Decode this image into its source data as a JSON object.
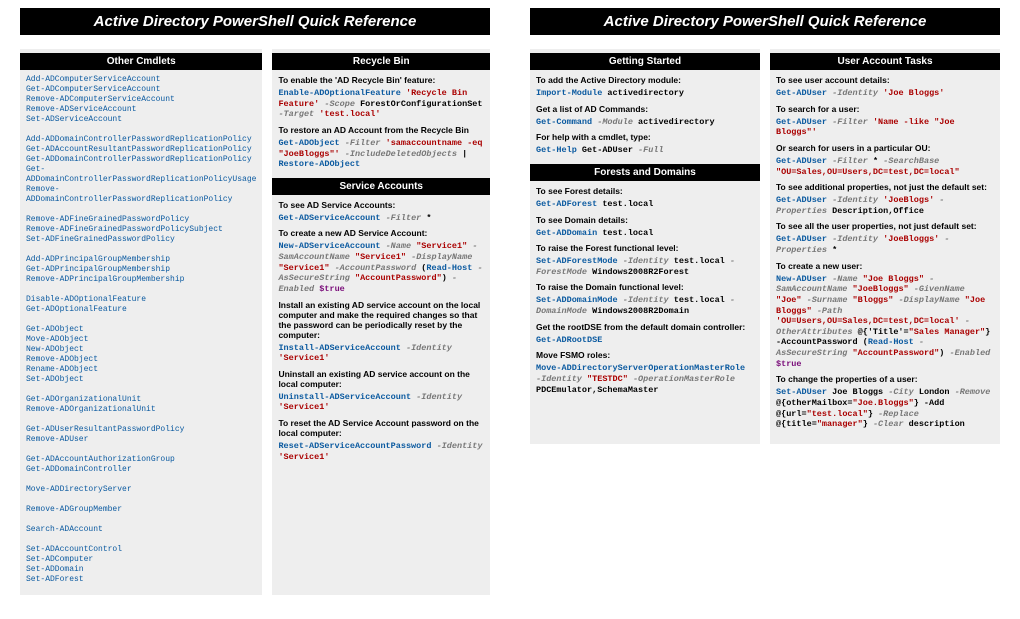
{
  "titles": {
    "left": "Active Directory PowerShell Quick Reference",
    "right": "Active Directory PowerShell Quick Reference"
  },
  "left": {
    "col1": {
      "header": "Other Cmdlets",
      "cmdlets": [
        "<span class='c-bl'>Add-ADComputerServiceAccount</span>",
        "<span class='c-bl'>Get-ADComputerServiceAccount</span>",
        "<span class='c-bl'>Remove-ADComputerServiceAccount</span>",
        "<span class='c-bl'>Remove-ADServiceAccount</span>",
        "<span class='c-bl'>Set-ADServiceAccount</span>",
        "",
        "<span class='c-bl'>Add-ADDomainControllerPasswordReplicationPolicy</span>",
        "<span class='c-bl'>Get-ADAccountResultantPasswordReplicationPolicy</span>",
        "<span class='c-bl'>Get-ADDomainControllerPasswordReplicationPolicy</span>",
        "<span class='c-bl'>Get-ADDomainControllerPasswordReplicationPolicyUsage</span>",
        "<span class='c-bl'>Remove-ADDomainControllerPasswordReplicationPolicy</span>",
        "",
        "<span class='c-bl'>Remove-ADFineGrainedPasswordPolicy</span>",
        "<span class='c-bl'>Remove-ADFineGrainedPasswordPolicySubject</span>",
        "<span class='c-bl'>Set-ADFineGrainedPasswordPolicy</span>",
        "",
        "<span class='c-bl'>Add-ADPrincipalGroupMembership</span>",
        "<span class='c-bl'>Get-ADPrincipalGroupMembership</span>",
        "<span class='c-bl'>Remove-ADPrincipalGroupMembership</span>",
        "",
        "<span class='c-bl'>Disable-ADOptionalFeature</span>",
        "<span class='c-bl'>Get-ADOptionalFeature</span>",
        "",
        "<span class='c-bl'>Get-ADObject</span>",
        "<span class='c-bl'>Move-ADObject</span>",
        "<span class='c-bl'>New-ADObject</span>",
        "<span class='c-bl'>Remove-ADObject</span>",
        "<span class='c-bl'>Rename-ADObject</span>",
        "<span class='c-bl'>Set-ADObject</span>",
        "",
        "<span class='c-bl'>Get-ADOrganizationalUnit</span>",
        "<span class='c-bl'>Remove-ADOrganizationalUnit</span>",
        "",
        "<span class='c-bl'>Get-ADUserResultantPasswordPolicy</span>",
        "<span class='c-bl'>Remove-ADUser</span>",
        "",
        "<span class='c-bl'>Get-ADAccountAuthorizationGroup</span>",
        "<span class='c-bl'>Get-ADDomainController</span>",
        "",
        "<span class='c-bl'>Move-ADDirectoryServer</span>",
        "",
        "<span class='c-bl'>Remove-ADGroupMember</span>",
        "",
        "<span class='c-bl'>Search-ADAccount</span>",
        "",
        "<span class='c-bl'>Set-ADAccountControl</span>",
        "<span class='c-bl'>Set-ADComputer</span>",
        "<span class='c-bl'>Set-ADDomain</span>",
        "<span class='c-bl'>Set-ADForest</span>"
      ]
    },
    "col2": {
      "sectA_header": "Recycle Bin",
      "a_desc1": "To enable the 'AD Recycle Bin' feature:",
      "a_code1": "<span class='c-bl'>Enable-ADOptionalFeature</span> <span class='c-rd'>'Recycle Bin Feature'</span> <span class='c-gy'>-Scope</span> <span class='c-dk'>ForestOrConfigurationSet</span> <span class='c-gy'>-Target</span> <span class='c-rd'>'test.local'</span>",
      "a_desc2": "To restore an AD Account from the Recycle Bin",
      "a_code2": "<span class='c-bl'>Get-ADObject</span> <span class='c-gy'>-Filter</span> <span class='c-rd'>'samaccountname -eq \"JoeBloggs\"'</span> <span class='c-gy'>-IncludeDeletedObjects</span> <span class='c-dk'>|</span> <span class='c-bl'>Restore-ADObject</span>",
      "sectB_header": "Service Accounts",
      "b_desc1": "To see AD Service Accounts:",
      "b_code1": "<span class='c-bl'>Get-ADServiceAccount</span> <span class='c-gy'>-Filter</span> <span class='c-dk'>*</span>",
      "b_desc2": "To create a new AD Service Account:",
      "b_code2": "<span class='c-bl'>New-ADServiceAccount</span> <span class='c-gy'>-Name</span> <span class='c-rd'>\"Service1\"</span> <span class='c-gy'>-SamAccountName</span> <span class='c-rd'>\"Service1\"</span> <span class='c-gy'>-DisplayName</span> <span class='c-rd'>\"Service1\"</span> <span class='c-gy'>-AccountPassword</span> <span class='c-dk'>(</span><span class='c-bl'>Read-Host</span> <span class='c-gy'>-AsSecureString</span> <span class='c-rd'>\"AccountPassword\"</span><span class='c-dk'>)</span> <span class='c-gy'>-Enabled</span> <span class='c-pu'>$true</span>",
      "b_desc3": "Install an existing AD service account on the local computer and make the required changes so that the password can be periodically reset by the computer:",
      "b_code3": "<span class='c-bl'>Install-ADServiceAccount</span> <span class='c-gy'>-Identity</span> <span class='c-rd'>'Service1'</span>",
      "b_desc4": "Uninstall an existing AD service account on the local computer:",
      "b_code4": "<span class='c-bl'>Uninstall-ADServiceAccount</span> <span class='c-gy'>-Identity</span> <span class='c-rd'>'Service1'</span>",
      "b_desc5": "To reset the AD Service Account password on the local computer:",
      "b_code5": "<span class='c-bl'>Reset-ADServiceAccountPassword</span> <span class='c-gy'>-Identity</span> <span class='c-rd'>'Service1'</span>"
    }
  },
  "right": {
    "col1": {
      "sectA_header": "Getting Started",
      "a_desc1": "To add the Active Directory module:",
      "a_code1": "<span class='c-bl'>Import-Module</span> <span class='c-dk'>activedirectory</span>",
      "a_desc2": "Get a list of AD Commands:",
      "a_code2": "<span class='c-bl'>Get-Command</span> <span class='c-gy'>-Module</span> <span class='c-dk'>activedirectory</span>",
      "a_desc3": "For help with a cmdlet, type:",
      "a_code3": "<span class='c-bl'>Get-Help</span> <span class='c-dk'>Get-ADUser</span> <span class='c-gy'>-Full</span>",
      "sectB_header": "Forests and Domains",
      "b_desc1": "To see Forest details:",
      "b_code1": "<span class='c-bl'>Get-ADForest</span> <span class='c-dk'>test.local</span>",
      "b_desc2": "To see Domain details:",
      "b_code2": "<span class='c-bl'>Get-ADDomain</span> <span class='c-dk'>test.local</span>",
      "b_desc3": "To raise the Forest functional level:",
      "b_code3": "<span class='c-bl'>Set-ADForestMode</span> <span class='c-gy'>-Identity</span> <span class='c-dk'>test.local</span> <span class='c-gy'>-ForestMode</span> <span class='c-dk'>Windows2008R2Forest</span>",
      "b_desc4": "To raise the Domain functional level:",
      "b_code4": "<span class='c-bl'>Set-ADDomainMode</span> <span class='c-gy'>-Identity</span> <span class='c-dk'>test.local</span> <span class='c-gy'>-DomainMode</span> <span class='c-dk'>Windows2008R2Domain</span>",
      "b_desc5": "Get the rootDSE from the default domain controller:",
      "b_code5": "<span class='c-bl'>Get-ADRootDSE</span>",
      "b_desc6": "Move FSMO roles:",
      "b_code6": "<span class='c-bl'>Move-ADDirectoryServerOperationMasterRole</span> <span class='c-gy'>-Identity</span> <span class='c-rd'>\"TESTDC\"</span> <span class='c-gy'>-OperationMasterRole</span> <span class='c-dk'>PDCEmulator,SchemaMaster</span>"
    },
    "col2": {
      "header": "User Account Tasks",
      "desc1": "To see user account details:",
      "code1": "<span class='c-bl'>Get-ADUser</span> <span class='c-gy'>-Identity</span> <span class='c-rd'>'Joe Bloggs'</span>",
      "desc2": "To search for a user:",
      "code2": "<span class='c-bl'>Get-ADUser</span> <span class='c-gy'>-Filter</span> <span class='c-rd'>'Name -like \"Joe Bloggs\"'</span>",
      "desc3": "Or search for users in a particular OU:",
      "code3": "<span class='c-bl'>Get-ADUser</span> <span class='c-gy'>-Filter</span> <span class='c-dk'>*</span> <span class='c-gy'>-SearchBase</span> <span class='c-rd'>\"OU=Sales,OU=Users,DC=test,DC=local\"</span>",
      "desc4": "To see additional properties, not just the default set:",
      "code4": "<span class='c-bl'>Get-ADUser</span> <span class='c-gy'>-Identity</span> <span class='c-rd'>'JoeBlogs'</span> <span class='c-gy'>-Properties</span> <span class='c-dk'>Description,Office</span>",
      "desc5": "To see all the user properties, not just default set:",
      "code5": "<span class='c-bl'>Get-ADUser</span> <span class='c-gy'>-Identity</span> <span class='c-rd'>'JoeBloggs'</span> <span class='c-gy'>-Properties</span> <span class='c-dk'>*</span>",
      "desc6": "To create a new user:",
      "code6": "<span class='c-bl'>New-ADUser</span> <span class='c-gy'>-Name</span> <span class='c-rd'>\"Joe Bloggs\"</span> <span class='c-gy'>-SamAccountName</span> <span class='c-rd'>\"JoeBloggs\"</span> <span class='c-gy'>-GivenName</span> <span class='c-rd'>\"Joe\"</span> <span class='c-gy'>-Surname</span> <span class='c-rd'>\"Bloggs\"</span> <span class='c-gy'>-DisplayName</span> <span class='c-rd'>\"Joe Bloggs\"</span> <span class='c-gy'>-Path</span> <span class='c-rd'>'OU=Users,OU=Sales,DC=test,DC=local'</span> <span class='c-gy'>-OtherAttributes</span> <span class='c-dk'>@{'Title'=</span><span class='c-rd'>\"Sales Manager\"</span><span class='c-dk'>} -AccountPassword (</span><span class='c-bl'>Read-Host</span> <span class='c-gy'>-AsSecureString</span> <span class='c-rd'>\"AccountPassword\"</span><span class='c-dk'>)</span> <span class='c-gy'>-Enabled</span> <span class='c-pu'>$true</span>",
      "desc7": "To change the properties of a user:",
      "code7": "<span class='c-bl'>Set-ADUser</span> <span class='c-dk'>Joe Bloggs</span> <span class='c-gy'>-City</span> <span class='c-dk'>London</span> <span class='c-gy'>-Remove</span> <span class='c-dk'>@{otherMailbox=</span><span class='c-rd'>\"Joe.Bloggs\"</span><span class='c-dk'>} -Add @{url=</span><span class='c-rd'>\"test.local\"</span><span class='c-dk'>}</span> <span class='c-gy'>-Replace</span> <span class='c-dk'>@{title=</span><span class='c-rd'>\"manager\"</span><span class='c-dk'>}</span> <span class='c-gy'>-Clear</span> <span class='c-dk'>description</span>"
    }
  }
}
